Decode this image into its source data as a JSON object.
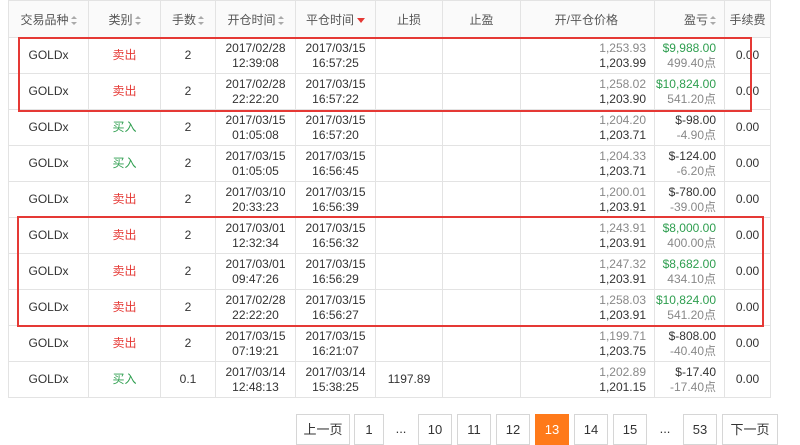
{
  "headers": {
    "symbol": "交易品种",
    "type": "类别",
    "lots": "手数",
    "open_time": "开仓时间",
    "close_time": "平仓时间",
    "stop_loss": "止损",
    "take_profit": "止盈",
    "prices": "开/平仓价格",
    "pnl": "盈亏",
    "fee": "手续费"
  },
  "rows": [
    {
      "symbol": "GOLDx",
      "type": "卖出",
      "side": "sell",
      "lots": "2",
      "open_date": "2017/02/28",
      "open_time": "12:39:08",
      "close_date": "2017/03/15",
      "close_time": "16:57:25",
      "sl": "",
      "tp": "",
      "open_price": "1,253.93",
      "close_price": "1,203.99",
      "pnl": "$9,988.00",
      "points": "499.40点",
      "pnl_sign": "positive",
      "fee": "0.00"
    },
    {
      "symbol": "GOLDx",
      "type": "卖出",
      "side": "sell",
      "lots": "2",
      "open_date": "2017/02/28",
      "open_time": "22:22:20",
      "close_date": "2017/03/15",
      "close_time": "16:57:22",
      "sl": "",
      "tp": "",
      "open_price": "1,258.02",
      "close_price": "1,203.90",
      "pnl": "$10,824.00",
      "points": "541.20点",
      "pnl_sign": "positive",
      "fee": "0.00"
    },
    {
      "symbol": "GOLDx",
      "type": "买入",
      "side": "buy",
      "lots": "2",
      "open_date": "2017/03/15",
      "open_time": "01:05:08",
      "close_date": "2017/03/15",
      "close_time": "16:57:20",
      "sl": "",
      "tp": "",
      "open_price": "1,204.20",
      "close_price": "1,203.71",
      "pnl": "$-98.00",
      "points": "-4.90点",
      "pnl_sign": "negative",
      "fee": "0.00"
    },
    {
      "symbol": "GOLDx",
      "type": "买入",
      "side": "buy",
      "lots": "2",
      "open_date": "2017/03/15",
      "open_time": "01:05:05",
      "close_date": "2017/03/15",
      "close_time": "16:56:45",
      "sl": "",
      "tp": "",
      "open_price": "1,204.33",
      "close_price": "1,203.71",
      "pnl": "$-124.00",
      "points": "-6.20点",
      "pnl_sign": "negative",
      "fee": "0.00"
    },
    {
      "symbol": "GOLDx",
      "type": "卖出",
      "side": "sell",
      "lots": "2",
      "open_date": "2017/03/10",
      "open_time": "20:33:23",
      "close_date": "2017/03/15",
      "close_time": "16:56:39",
      "sl": "",
      "tp": "",
      "open_price": "1,200.01",
      "close_price": "1,203.91",
      "pnl": "$-780.00",
      "points": "-39.00点",
      "pnl_sign": "negative",
      "fee": "0.00"
    },
    {
      "symbol": "GOLDx",
      "type": "卖出",
      "side": "sell",
      "lots": "2",
      "open_date": "2017/03/01",
      "open_time": "12:32:34",
      "close_date": "2017/03/15",
      "close_time": "16:56:32",
      "sl": "",
      "tp": "",
      "open_price": "1,243.91",
      "close_price": "1,203.91",
      "pnl": "$8,000.00",
      "points": "400.00点",
      "pnl_sign": "positive",
      "fee": "0.00"
    },
    {
      "symbol": "GOLDx",
      "type": "卖出",
      "side": "sell",
      "lots": "2",
      "open_date": "2017/03/01",
      "open_time": "09:47:26",
      "close_date": "2017/03/15",
      "close_time": "16:56:29",
      "sl": "",
      "tp": "",
      "open_price": "1,247.32",
      "close_price": "1,203.91",
      "pnl": "$8,682.00",
      "points": "434.10点",
      "pnl_sign": "positive",
      "fee": "0.00"
    },
    {
      "symbol": "GOLDx",
      "type": "卖出",
      "side": "sell",
      "lots": "2",
      "open_date": "2017/02/28",
      "open_time": "22:22:20",
      "close_date": "2017/03/15",
      "close_time": "16:56:27",
      "sl": "",
      "tp": "",
      "open_price": "1,258.03",
      "close_price": "1,203.91",
      "pnl": "$10,824.00",
      "points": "541.20点",
      "pnl_sign": "positive",
      "fee": "0.00"
    },
    {
      "symbol": "GOLDx",
      "type": "卖出",
      "side": "sell",
      "lots": "2",
      "open_date": "2017/03/15",
      "open_time": "07:19:21",
      "close_date": "2017/03/15",
      "close_time": "16:21:07",
      "sl": "",
      "tp": "",
      "open_price": "1,199.71",
      "close_price": "1,203.75",
      "pnl": "$-808.00",
      "points": "-40.40点",
      "pnl_sign": "negative",
      "fee": "0.00"
    },
    {
      "symbol": "GOLDx",
      "type": "买入",
      "side": "buy",
      "lots": "0.1",
      "open_date": "2017/03/14",
      "open_time": "12:48:13",
      "close_date": "2017/03/14",
      "close_time": "15:38:25",
      "sl": "1197.89",
      "tp": "",
      "open_price": "1,202.89",
      "close_price": "1,201.15",
      "pnl": "$-17.40",
      "points": "-17.40点",
      "pnl_sign": "negative",
      "fee": "0.00"
    }
  ],
  "pagination": {
    "prev": "上一页",
    "p1": "1",
    "ellipsis1": "...",
    "p10": "10",
    "p11": "11",
    "p12": "12",
    "p13": "13",
    "p14": "14",
    "p15": "15",
    "ellipsis2": "...",
    "p53": "53",
    "next": "下一页",
    "current": "13"
  },
  "colors": {
    "sell": "#e53935",
    "buy": "#2e9e4f",
    "profit": "#2e9e4f",
    "highlight_box": "#e53935",
    "active_page": "#ff7a1a"
  }
}
